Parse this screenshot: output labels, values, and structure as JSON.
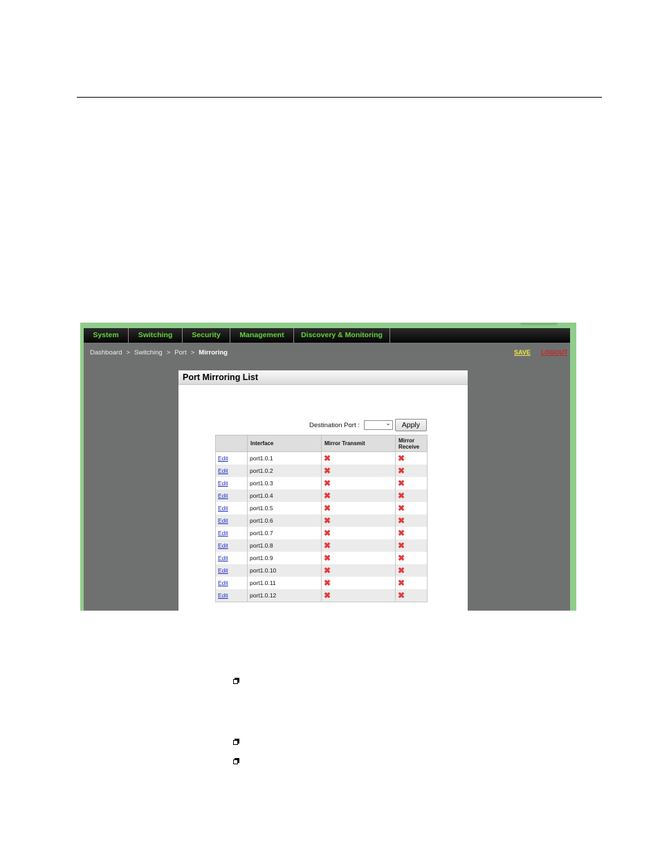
{
  "nav": {
    "items": [
      {
        "label": "System"
      },
      {
        "label": "Switching"
      },
      {
        "label": "Security"
      },
      {
        "label": "Management"
      },
      {
        "label": "Discovery & Monitoring"
      }
    ]
  },
  "breadcrumb": {
    "items": [
      "Dashboard",
      "Switching",
      "Port"
    ],
    "current": "Mirroring",
    "separator": ">"
  },
  "top_links": {
    "save": "SAVE",
    "logout": "LOGOUT"
  },
  "panel": {
    "title": "Port Mirroring List",
    "destination_label": "Destination Port :",
    "destination_value": "",
    "apply_label": "Apply"
  },
  "table": {
    "headers": [
      "",
      "Interface",
      "Mirror Transmit",
      "Mirror Receive"
    ],
    "edit_label": "Edit",
    "status_icon": "red-x-icon",
    "rows": [
      {
        "interface": "port1.0.1",
        "transmit": "✖",
        "receive": "✖"
      },
      {
        "interface": "port1.0.2",
        "transmit": "✖",
        "receive": "✖"
      },
      {
        "interface": "port1.0.3",
        "transmit": "✖",
        "receive": "✖"
      },
      {
        "interface": "port1.0.4",
        "transmit": "✖",
        "receive": "✖"
      },
      {
        "interface": "port1.0.5",
        "transmit": "✖",
        "receive": "✖"
      },
      {
        "interface": "port1.0.6",
        "transmit": "✖",
        "receive": "✖"
      },
      {
        "interface": "port1.0.7",
        "transmit": "✖",
        "receive": "✖"
      },
      {
        "interface": "port1.0.8",
        "transmit": "✖",
        "receive": "✖"
      },
      {
        "interface": "port1.0.9",
        "transmit": "✖",
        "receive": "✖"
      },
      {
        "interface": "port1.0.10",
        "transmit": "✖",
        "receive": "✖"
      },
      {
        "interface": "port1.0.11",
        "transmit": "✖",
        "receive": "✖"
      },
      {
        "interface": "port1.0.12",
        "transmit": "✖",
        "receive": "✖"
      }
    ]
  },
  "colors": {
    "nav_text": "#66d13c",
    "frame_border": "#8fcd8b",
    "app_background": "#6f7170",
    "save_link": "#f0e64a",
    "logout_link": "#c0282a",
    "x_mark": "#e23a3a"
  }
}
